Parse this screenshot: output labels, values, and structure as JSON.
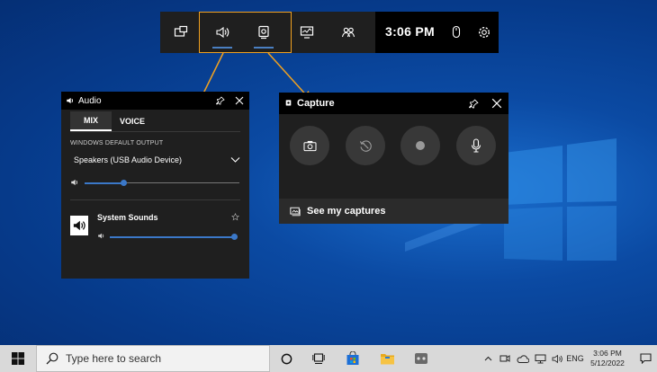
{
  "colors": {
    "accent": "#3b78c8",
    "highlight": "#f0a120",
    "gamebar_bg": "#1f1f1f"
  },
  "gamebar": {
    "time": "3:06 PM",
    "buttons": [
      "widget-menu-icon",
      "audio-icon",
      "capture-icon",
      "performance-icon",
      "social-icon",
      "mouse-icon",
      "gear-icon"
    ]
  },
  "audio": {
    "title": "Audio",
    "tabs": [
      "MIX",
      "VOICE"
    ],
    "default_output_label": "WINDOWS DEFAULT OUTPUT",
    "device": "Speakers (USB Audio Device)",
    "master_volume": 0.25,
    "app_name": "System Sounds",
    "app_volume": 1.0
  },
  "capture": {
    "title": "Capture",
    "see_captures": "See my captures",
    "buttons": [
      "camera-icon",
      "record-last-icon",
      "record-icon",
      "microphone-icon"
    ]
  },
  "taskbar": {
    "search_placeholder": "Type here to search",
    "lang": "ENG",
    "time": "3:06 PM",
    "date": "5/12/2022"
  }
}
